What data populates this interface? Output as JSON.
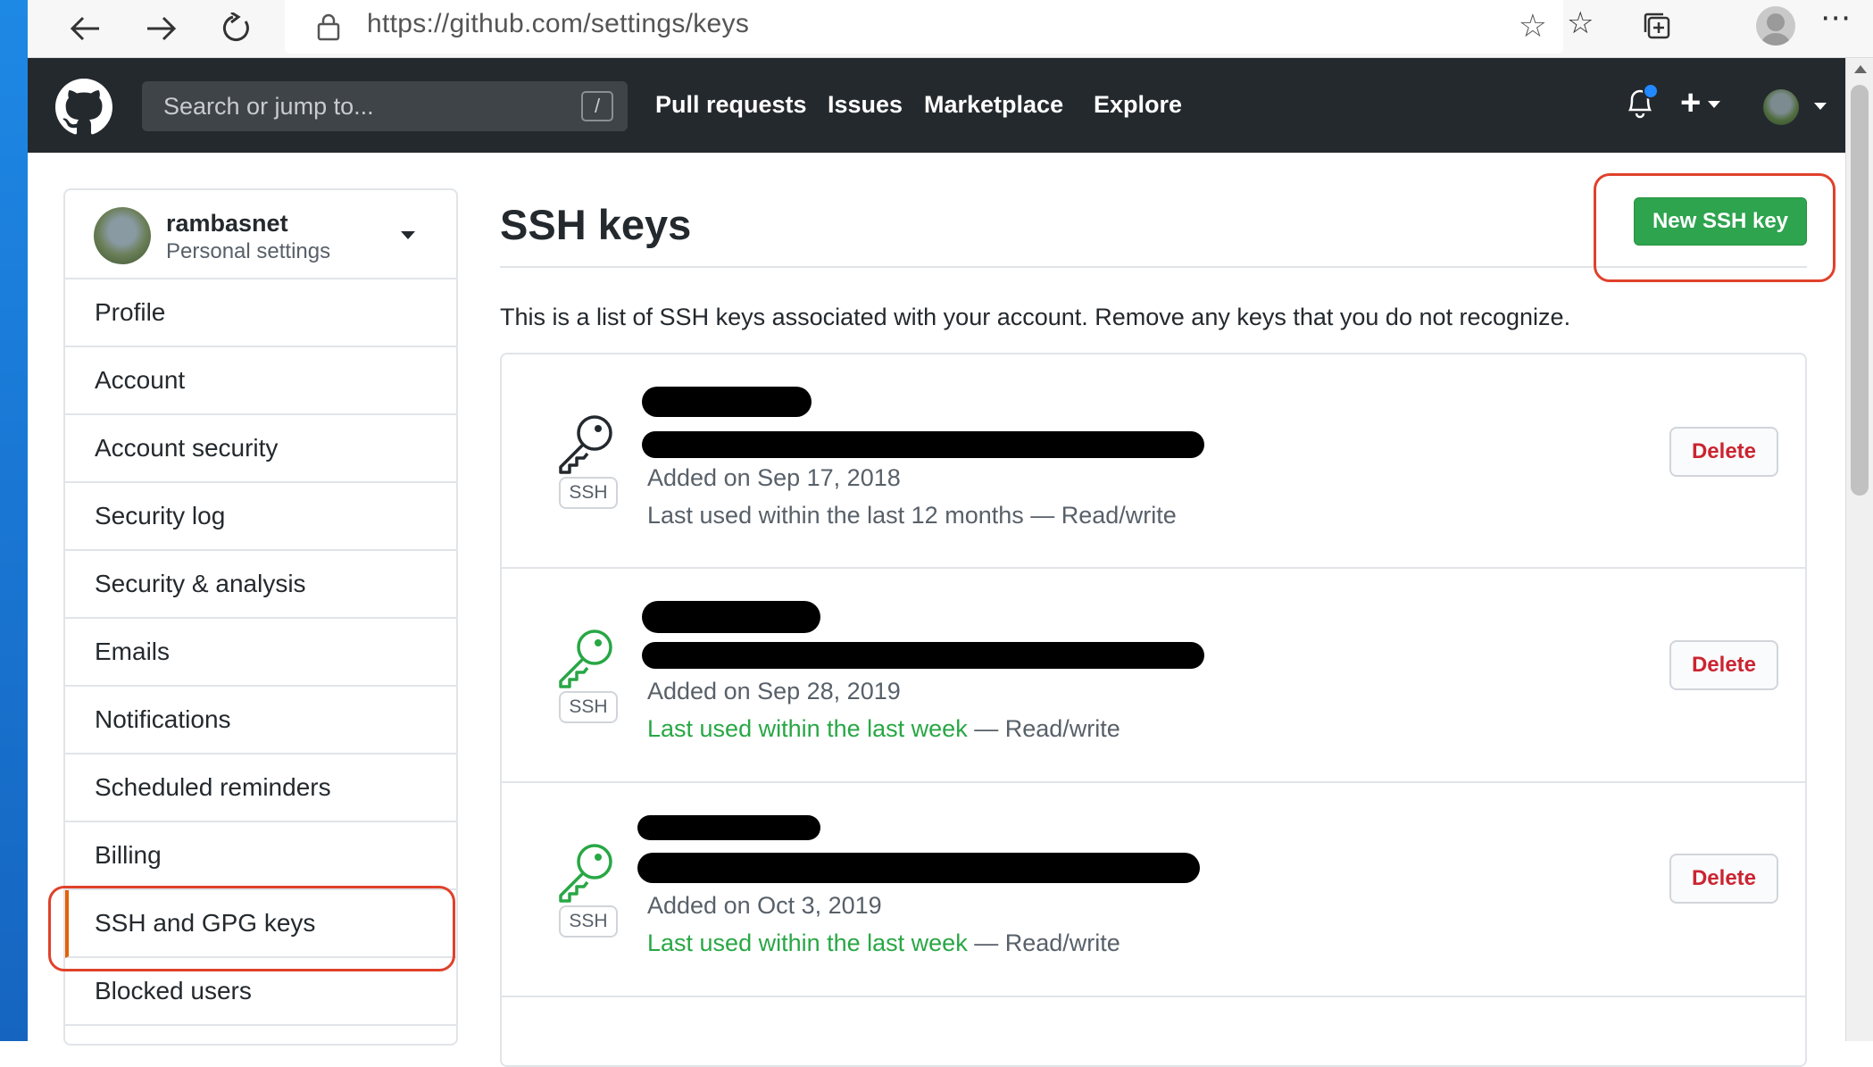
{
  "browser": {
    "url": "https://github.com/settings/keys"
  },
  "header": {
    "search_placeholder": "Search or jump to...",
    "slash_hint": "/",
    "nav": [
      "Pull requests",
      "Issues",
      "Marketplace",
      "Explore"
    ]
  },
  "sidebar": {
    "username": "rambasnet",
    "subtitle": "Personal settings",
    "items": [
      {
        "label": "Profile"
      },
      {
        "label": "Account"
      },
      {
        "label": "Account security"
      },
      {
        "label": "Security log"
      },
      {
        "label": "Security & analysis"
      },
      {
        "label": "Emails"
      },
      {
        "label": "Notifications"
      },
      {
        "label": "Scheduled reminders"
      },
      {
        "label": "Billing"
      },
      {
        "label": "SSH and GPG keys",
        "selected": true
      },
      {
        "label": "Blocked users"
      }
    ]
  },
  "main": {
    "title": "SSH keys",
    "new_key_button": "New SSH key",
    "intro": "This is a list of SSH keys associated with your account. Remove any keys that you do not recognize.",
    "keys": [
      {
        "badge": "SSH",
        "added": "Added on Sep 17, 2018",
        "last_used": "Last used within the last 12 months",
        "access": " — Read/write",
        "recent": false,
        "delete_label": "Delete"
      },
      {
        "badge": "SSH",
        "added": "Added on Sep 28, 2019",
        "last_used": "Last used within the last week",
        "access": " — Read/write",
        "recent": true,
        "delete_label": "Delete"
      },
      {
        "badge": "SSH",
        "added": "Added on Oct 3, 2019",
        "last_used": "Last used within the last week",
        "access": " — Read/write",
        "recent": true,
        "delete_label": "Delete"
      }
    ]
  },
  "colors": {
    "header_bg": "#24292e",
    "primary_green": "#2ea44f",
    "danger_red": "#cb2431",
    "recent_green": "#28a745",
    "annotation_red": "#e0412b"
  }
}
